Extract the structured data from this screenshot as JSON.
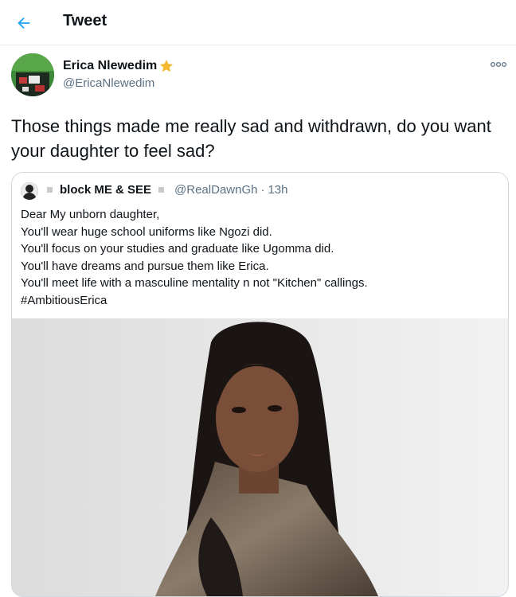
{
  "header": {
    "back_icon": "arrow-left-icon",
    "title": "Tweet",
    "accent_color": "#1da1f2"
  },
  "tweet": {
    "author": {
      "name": "Erica Nlewedim",
      "badge_icon": "star-icon",
      "badge_color": "#f5b82e",
      "handle": "@EricaNlewedim"
    },
    "more_icon": "more-icon",
    "text": "Those things made me really sad and withdrawn, do you want your daughter to feel sad?"
  },
  "quoted_tweet": {
    "name": "block ME & SEE",
    "handle": "@RealDawnGh",
    "separator": "·",
    "time": "13h",
    "text": "Dear My unborn daughter,\nYou'll wear huge school uniforms like Ngozi did.\nYou'll focus on your studies and graduate like Ugomma did.\nYou'll have dreams and pursue them like Erica.\nYou'll meet life with a masculine mentality n not \"Kitchen\" callings.\n#AmbitiousErica"
  }
}
